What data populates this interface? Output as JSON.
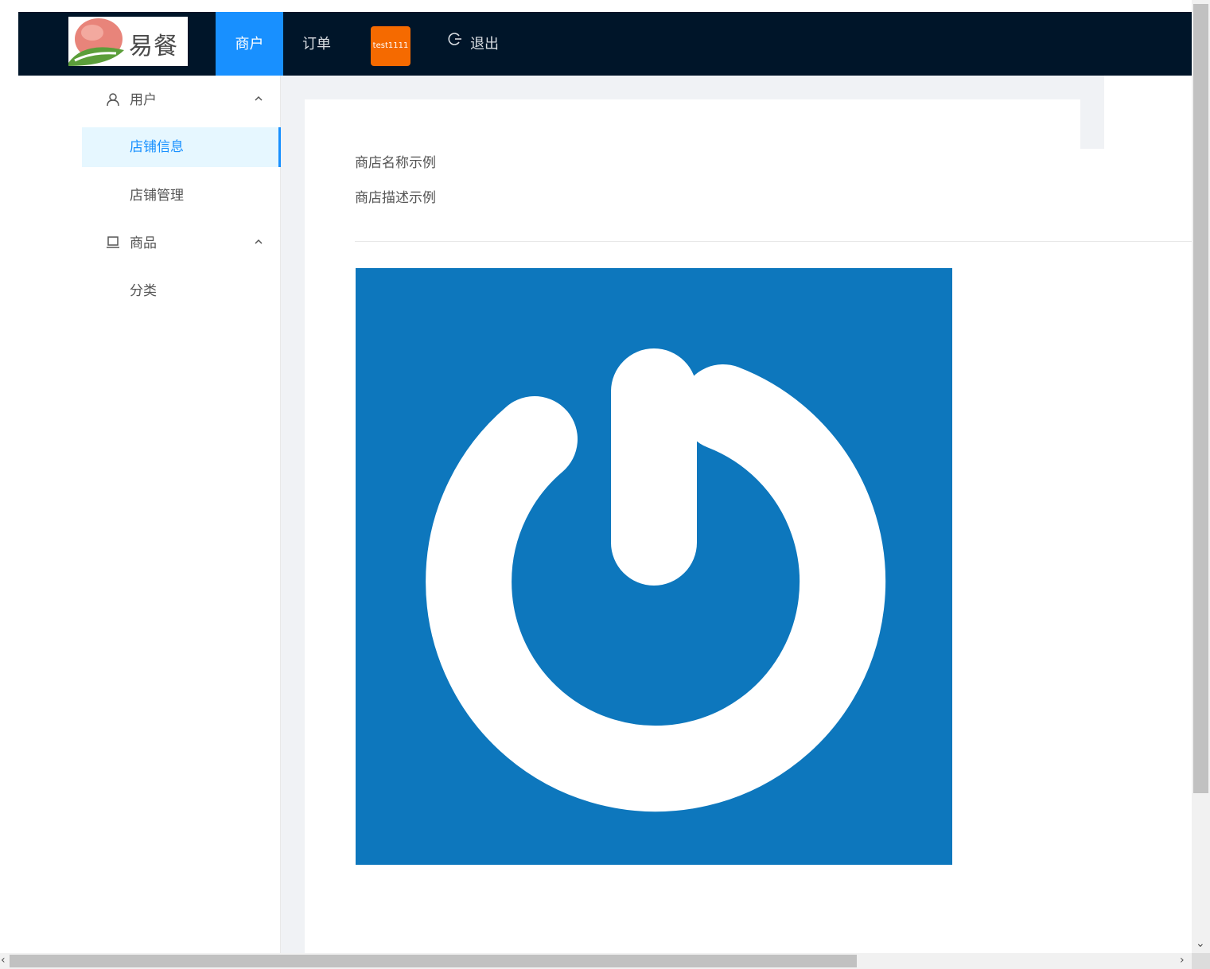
{
  "header": {
    "logo_text": "易餐",
    "nav": {
      "merchant": "商户",
      "order": "订单",
      "user_badge": "test1111",
      "logout": "退出"
    }
  },
  "sidebar": {
    "user_group": "用户",
    "user_items": [
      "店铺信息",
      "店铺管理"
    ],
    "goods_group": "商品",
    "goods_items": [
      "分类"
    ]
  },
  "content": {
    "shop_name": "商店名称示例",
    "shop_desc": "商店描述示例"
  },
  "colors": {
    "header_bg": "#001529",
    "accent": "#1890ff",
    "badge": "#f56a00",
    "image_bg": "#0d77bd"
  }
}
